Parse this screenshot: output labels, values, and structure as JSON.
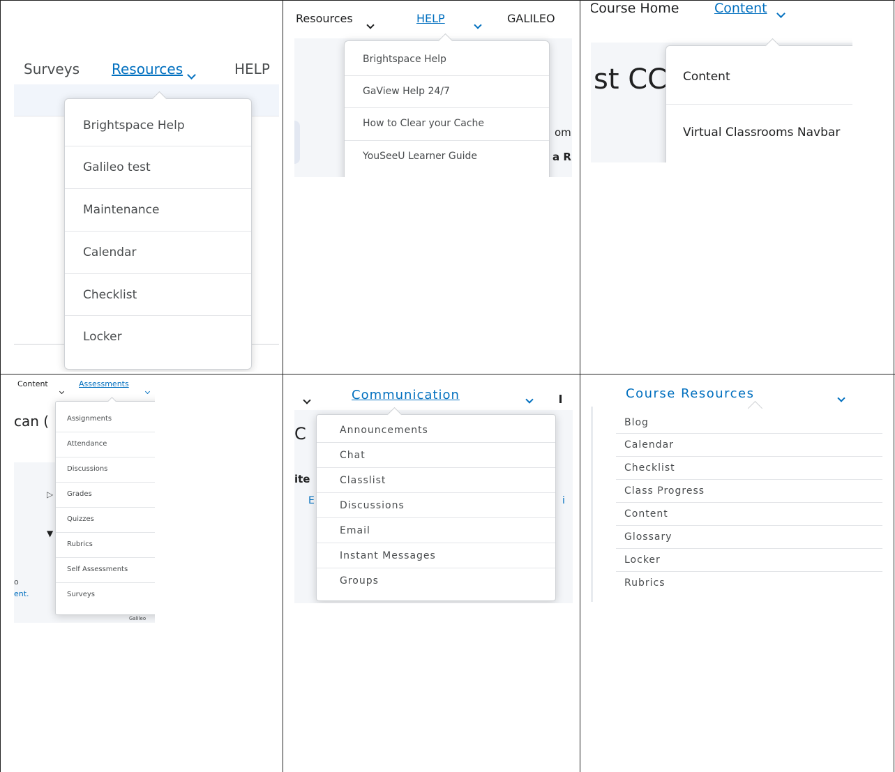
{
  "panel1": {
    "nav": [
      "Surveys",
      "Resources",
      "HELP"
    ],
    "menu": [
      "Brightspace Help",
      "Galileo test",
      "Maintenance",
      "Calendar",
      "Checklist",
      "Locker"
    ]
  },
  "panel2": {
    "nav": [
      "Resources",
      "HELP",
      "GALILEO"
    ],
    "menu": [
      "Brightspace Help",
      "GaView Help 24/7",
      "How to Clear your Cache",
      "YouSeeU Learner Guide"
    ],
    "behind": [
      "om",
      "a R"
    ]
  },
  "panel3": {
    "nav": [
      "Course Home",
      "Content"
    ],
    "title_fragment": "st CC",
    "menu": [
      "Content",
      "Virtual Classrooms Navbar"
    ]
  },
  "panel4": {
    "nav": [
      "Content",
      "Assessments"
    ],
    "title_fragment": "can (",
    "menu": [
      "Assignments",
      "Attendance",
      "Discussions",
      "Grades",
      "Quizzes",
      "Rubrics",
      "Self Assessments",
      "Surveys"
    ],
    "behind": [
      "o",
      "ent.",
      "Galileo"
    ]
  },
  "panel5": {
    "nav": [
      "Communication"
    ],
    "title_fragment": "C",
    "menu": [
      "Announcements",
      "Chat",
      "Classlist",
      "Discussions",
      "Email",
      "Instant Messages",
      "Groups"
    ],
    "behind": [
      "ite",
      "E",
      "i"
    ]
  },
  "panel6": {
    "nav": [
      "Course Resources"
    ],
    "menu": [
      "Blog",
      "Calendar",
      "Checklist",
      "Class Progress",
      "Content",
      "Glossary",
      "Locker",
      "Rubrics"
    ]
  }
}
